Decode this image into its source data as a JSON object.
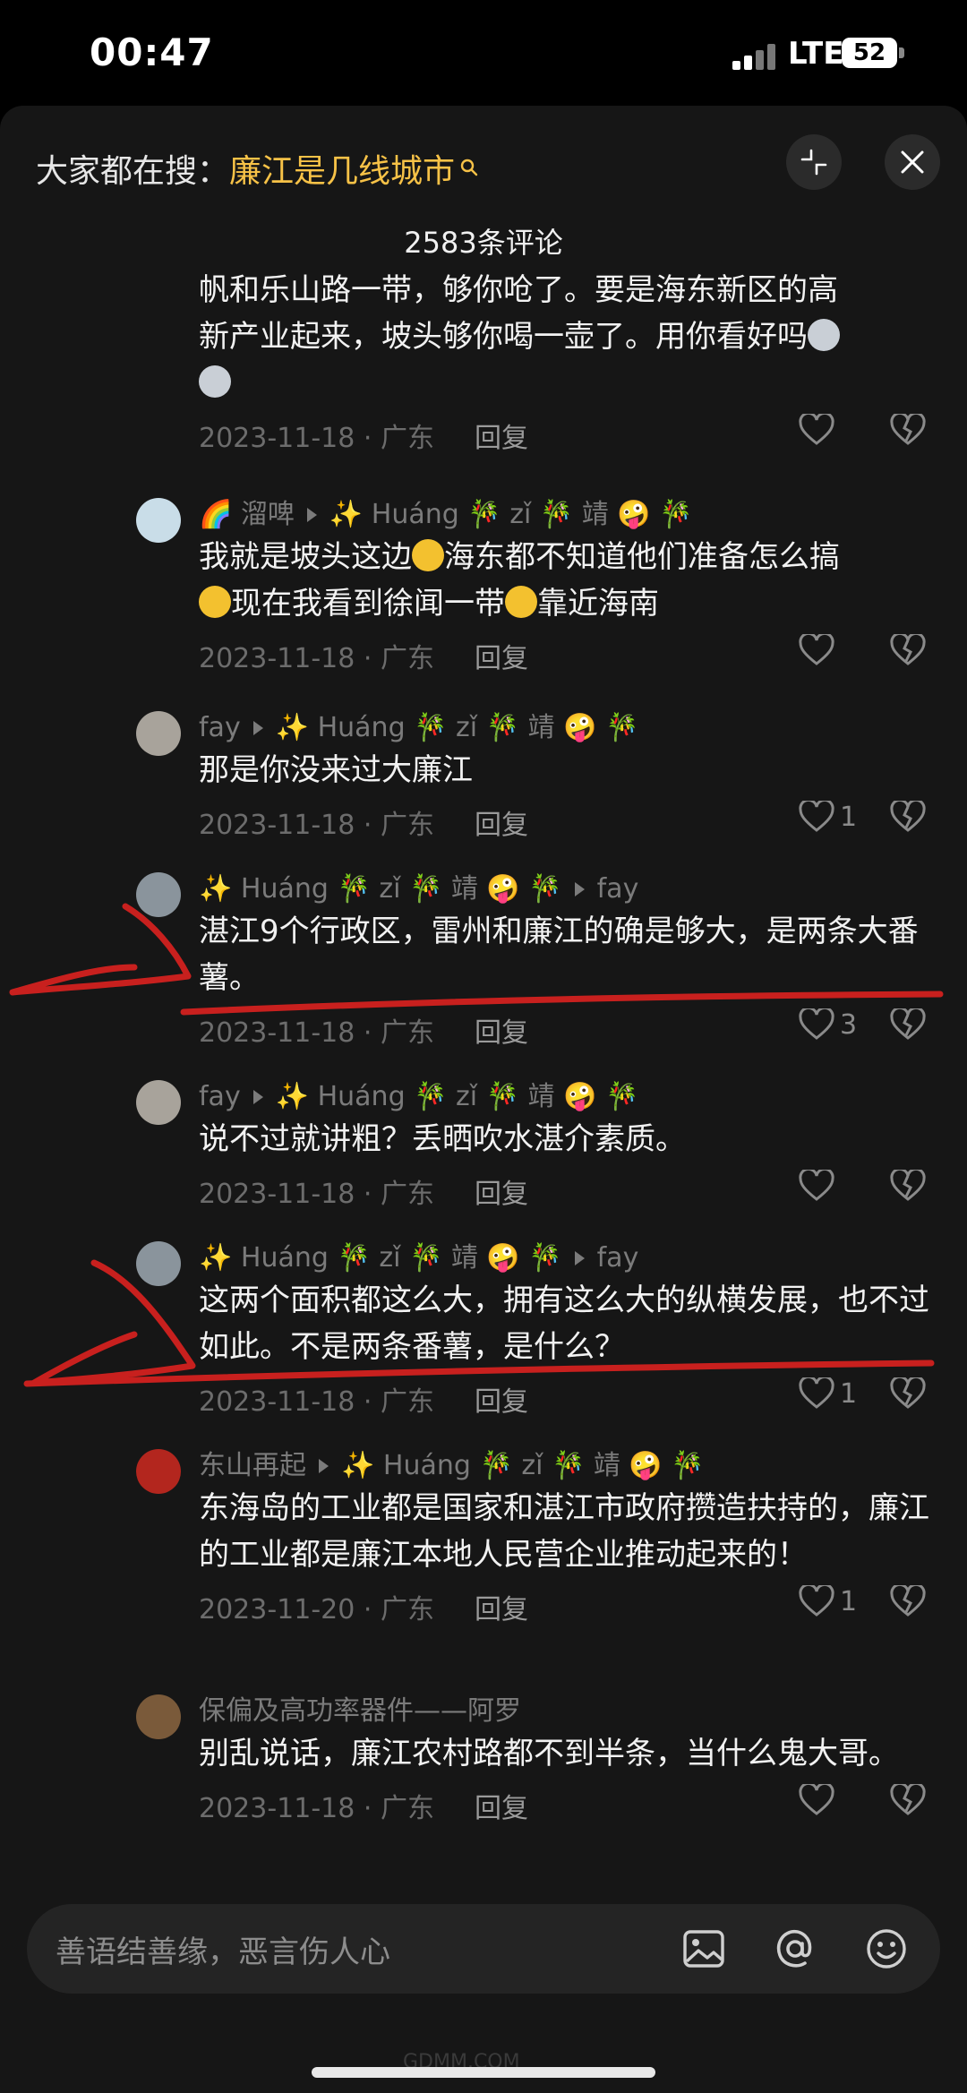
{
  "status_bar": {
    "time": "00:47",
    "network": "LTE",
    "battery": "52"
  },
  "header": {
    "search_prefix": "大家都在搜：",
    "search_term": "廉江是几线城市",
    "comment_count": "2583条评论"
  },
  "partial_comment": {
    "lines": [
      "帆和乐山路一带，够你呛了。要是海东新区的高",
      "新产业起来，坡头够你喝一壶了。用你看好吗"
    ],
    "date": "2023-11-18 · 广东",
    "reply": "回复"
  },
  "comments": [
    {
      "author": "🌈 溜啤",
      "reply_to": "✨ Huáng 🎋 zǐ 🎋 靖 🤪 🎋",
      "text_parts": [
        "我就是坡头这边",
        "海东都不知道他们准备怎么搞",
        "现在我看到徐闻一带",
        "靠近海南"
      ],
      "date": "2023-11-18 · 广东",
      "reply": "回复",
      "likes": ""
    },
    {
      "author": "fay",
      "reply_to": "✨ Huáng 🎋 zǐ 🎋 靖 🤪 🎋",
      "text": "那是你没来过大廉江",
      "date": "2023-11-18 · 广东",
      "reply": "回复",
      "likes": "1"
    },
    {
      "author": "✨ Huáng 🎋 zǐ 🎋 靖 🤪 🎋",
      "reply_to": "fay",
      "text": "湛江9个行政区，雷州和廉江的确是够大，是两条大番薯。",
      "date": "2023-11-18 · 广东",
      "reply": "回复",
      "likes": "3"
    },
    {
      "author": "fay",
      "reply_to": "✨ Huáng 🎋 zǐ 🎋 靖 🤪 🎋",
      "text": "说不过就讲粗？丢晒吹水湛介素质。",
      "date": "2023-11-18 · 广东",
      "reply": "回复",
      "likes": ""
    },
    {
      "author": "✨ Huáng 🎋 zǐ 🎋 靖 🤪 🎋",
      "reply_to": "fay",
      "text": "这两个面积都这么大，拥有这么大的纵横发展，也不过如此。不是两条番薯，是什么？",
      "date": "2023-11-18 · 广东",
      "reply": "回复",
      "likes": "1"
    },
    {
      "author": "东山再起",
      "reply_to": "✨ Huáng 🎋 zǐ 🎋 靖 🤪 🎋",
      "text": "东海岛的工业都是国家和湛江市政府攒造扶持的，廉江的工业都是廉江本地人民营企业推动起来的！",
      "date": "2023-11-20 · 广东",
      "reply": "回复",
      "likes": "1"
    },
    {
      "author": "保偏及高功率器件——阿罗",
      "reply_to": "",
      "text": "别乱说话，廉江农村路都不到半条，当什么鬼大哥。",
      "date": "2023-11-18 · 广东",
      "reply": "回复",
      "likes": ""
    }
  ],
  "input": {
    "placeholder": "善语结善缘，恶言伤人心"
  },
  "watermark": "GDMM.COM",
  "colors": {
    "accent": "#f7c247",
    "annotation": "#c8201e",
    "background": "#161616"
  }
}
